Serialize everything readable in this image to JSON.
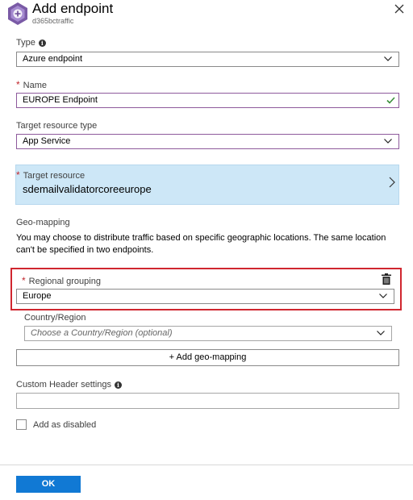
{
  "header": {
    "title": "Add endpoint",
    "subtitle": "d365bctraffic",
    "logo_icon": "traffic-manager-icon",
    "close_icon": "close-icon"
  },
  "form": {
    "type": {
      "label": "Type",
      "value": "Azure endpoint"
    },
    "name": {
      "label": "Name",
      "value": "EUROPE Endpoint",
      "required_marker": "*"
    },
    "target_resource_type": {
      "label": "Target resource type",
      "value": "App Service"
    },
    "target_resource": {
      "label": "Target resource",
      "value": "sdemailvalidatorcoreeurope",
      "required_marker": "*"
    },
    "geo_mapping": {
      "heading": "Geo-mapping",
      "description": "You may choose to distribute traffic based on specific geographic locations. The same location can't be specified in two endpoints."
    },
    "regional_grouping": {
      "label": "Regional grouping",
      "value": "Europe",
      "required_marker": "*"
    },
    "country_region": {
      "label": "Country/Region",
      "placeholder": "Choose a Country/Region (optional)"
    },
    "add_geo_mapping": "+ Add geo-mapping",
    "custom_header": {
      "label": "Custom Header settings",
      "value": ""
    },
    "add_as_disabled": {
      "label": "Add as disabled",
      "checked": false
    }
  },
  "footer": {
    "ok_label": "OK"
  },
  "colors": {
    "accent_blue": "#1179d4",
    "selected_bg": "#cde7f7",
    "highlight_red": "#d0262f",
    "input_focus_purple": "#8e5a9c",
    "valid_green": "#3a8f3a",
    "required_red": "#c1272d"
  }
}
